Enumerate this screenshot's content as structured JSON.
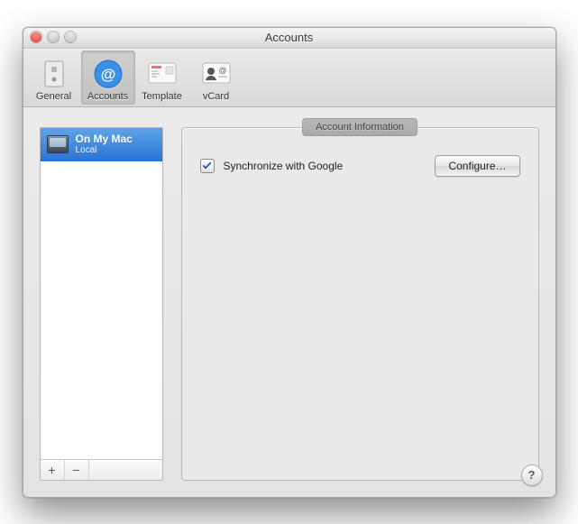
{
  "window": {
    "title": "Accounts"
  },
  "toolbar": {
    "items": [
      {
        "label": "General"
      },
      {
        "label": "Accounts"
      },
      {
        "label": "Template"
      },
      {
        "label": "vCard"
      }
    ],
    "selected_index": 1
  },
  "sidebar": {
    "accounts": [
      {
        "name": "On My Mac",
        "subtitle": "Local",
        "selected": true
      }
    ],
    "add_label": "+",
    "remove_label": "−"
  },
  "panel": {
    "group_title": "Account Information",
    "sync_checkbox_label": "Synchronize with Google",
    "sync_checked": true,
    "configure_label": "Configure…"
  },
  "help_label": "?"
}
